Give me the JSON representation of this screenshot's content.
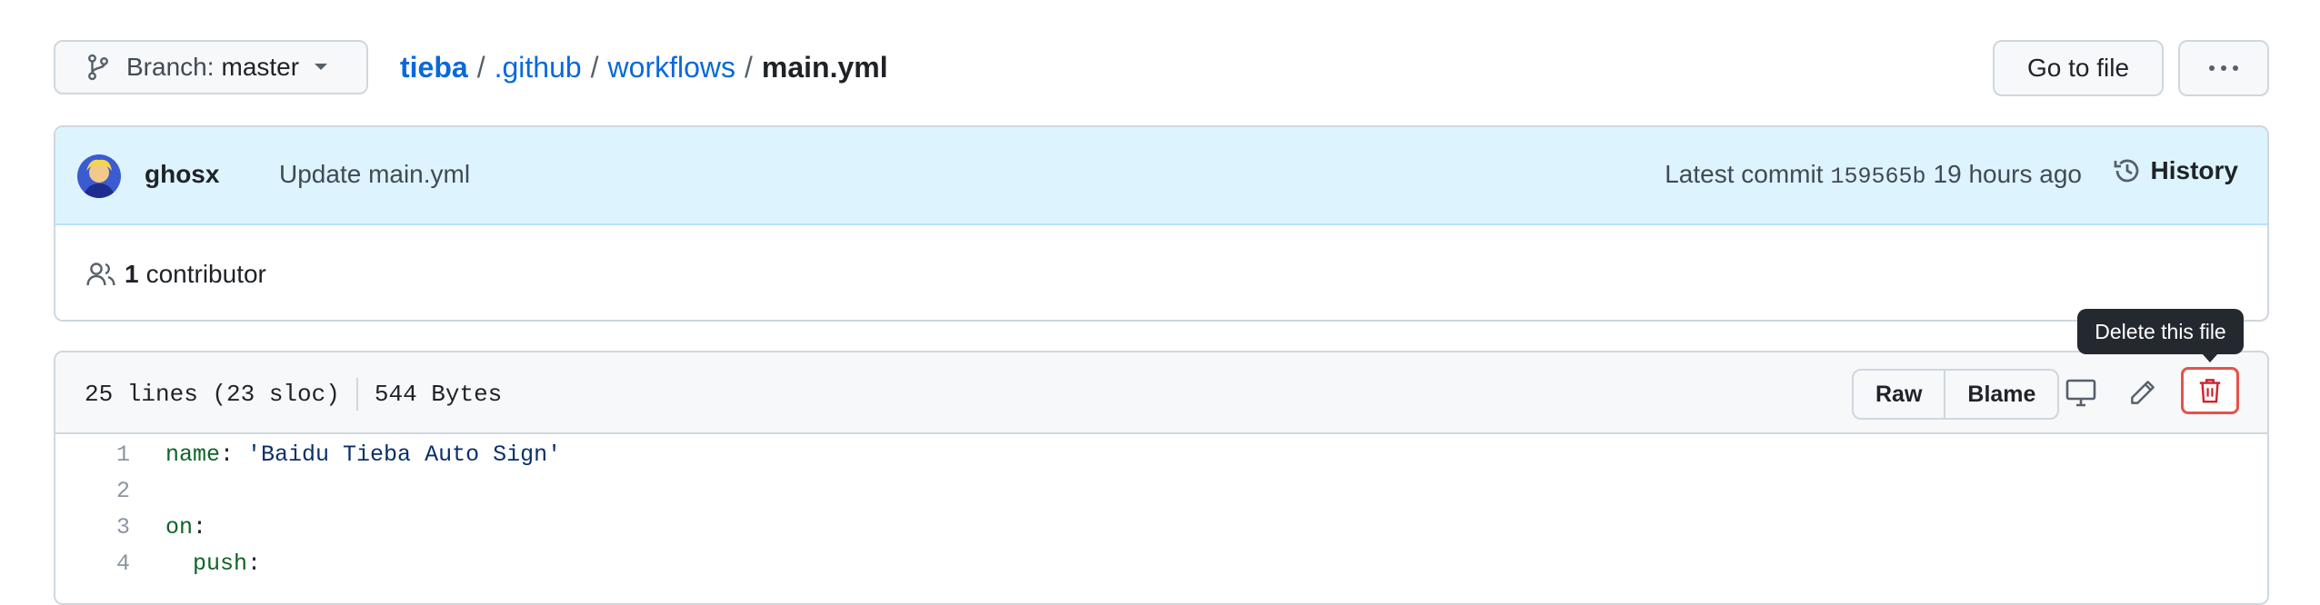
{
  "branch": {
    "label": "Branch:",
    "name": "master"
  },
  "breadcrumb": {
    "repo": "tieba",
    "sep": "/",
    "dir1": ".github",
    "dir2": "workflows",
    "file": "main.yml"
  },
  "header_buttons": {
    "goto": "Go to file"
  },
  "commit": {
    "author": "ghosx",
    "message": "Update main.yml",
    "latest_label": "Latest commit",
    "sha": "159565b",
    "time": "19 hours ago",
    "history": "History"
  },
  "contributors": {
    "count": "1",
    "label": "contributor"
  },
  "file": {
    "lines": "25 lines (23 sloc)",
    "size": "544 Bytes",
    "raw": "Raw",
    "blame": "Blame",
    "tooltip": "Delete this file"
  },
  "code": [
    {
      "n": "1",
      "key": "name",
      "punct": ": ",
      "val": "'Baidu Tieba Auto Sign'"
    },
    {
      "n": "2",
      "key": "",
      "punct": "",
      "val": ""
    },
    {
      "n": "3",
      "key": "on",
      "punct": ":",
      "val": ""
    },
    {
      "n": "4",
      "key": "  push",
      "punct": ":",
      "val": ""
    }
  ],
  "colors": {
    "link": "#0969da",
    "delete": "#cf222e",
    "commit_bg": "#ddf4ff"
  }
}
